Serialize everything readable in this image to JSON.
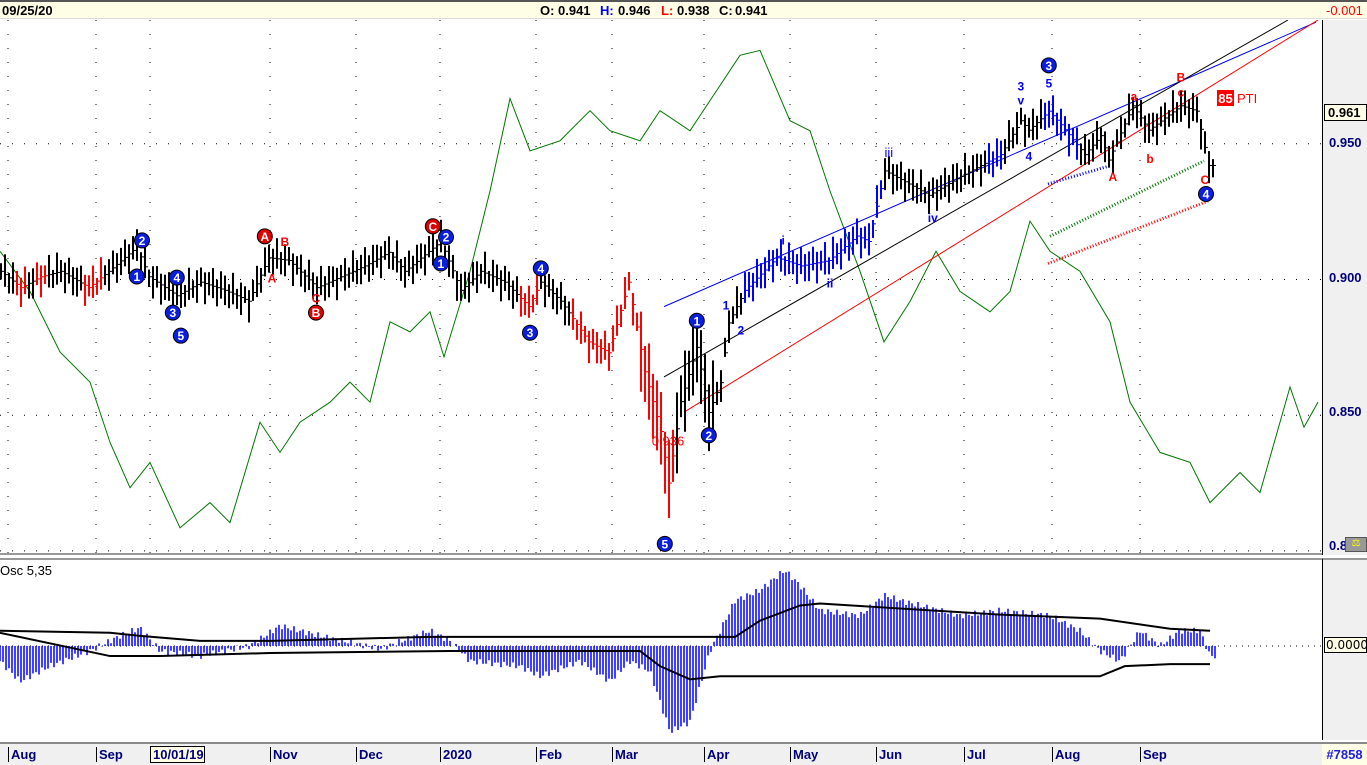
{
  "header": {
    "date": "09/25/20",
    "open_label": "O:",
    "open": "0.941",
    "high_label": "H:",
    "high": "0.946",
    "low_label": "L:",
    "low": "0.938",
    "close_label": "C:",
    "close": "0.941",
    "change": "-0.001"
  },
  "price_axis": {
    "ticks": [
      "0.950",
      "0.900",
      "0.850",
      "0.8"
    ],
    "current": "0.961"
  },
  "osc_panel": {
    "title": "Osc 5,35",
    "zero_label": "0.0000"
  },
  "x_axis": {
    "labels": [
      "Aug",
      "Sep",
      "10/01/19",
      "Nov",
      "Dec",
      "2020",
      "Feb",
      "Mar",
      "Apr",
      "May",
      "Jun",
      "Jul",
      "Aug",
      "Sep"
    ]
  },
  "record": "#7858",
  "pti": {
    "value": "85",
    "label": "PTI"
  },
  "colors": {
    "up": "#000000",
    "red": "#ff0000",
    "blue": "#0000ff",
    "green": "#007700"
  },
  "chart_data": {
    "type": "ohlc",
    "title": "09/25/20",
    "ylim": [
      0.7985,
      0.9956
    ],
    "yticks": [
      0.95,
      0.9,
      0.85,
      0.8
    ],
    "bar_count": 304,
    "month_starts": [
      2,
      24,
      37.5,
      67.5,
      89,
      110,
      134,
      153,
      176,
      197.5,
      219,
      241,
      263,
      285
    ],
    "price_path": [
      [
        0,
        0.903
      ],
      [
        5,
        0.897
      ],
      [
        10,
        0.901
      ],
      [
        15,
        0.903
      ],
      [
        22,
        0.897
      ],
      [
        27,
        0.903
      ],
      [
        34,
        0.912
      ],
      [
        37,
        0.901
      ],
      [
        44,
        0.894
      ],
      [
        50,
        0.899
      ],
      [
        56,
        0.896
      ],
      [
        62,
        0.892
      ],
      [
        67,
        0.908
      ],
      [
        72,
        0.907
      ],
      [
        79,
        0.897
      ],
      [
        85,
        0.901
      ],
      [
        91,
        0.905
      ],
      [
        97,
        0.91
      ],
      [
        101,
        0.903
      ],
      [
        110,
        0.914
      ],
      [
        115,
        0.896
      ],
      [
        120,
        0.903
      ],
      [
        126,
        0.899
      ],
      [
        132,
        0.89
      ],
      [
        135,
        0.899
      ],
      [
        140,
        0.892
      ],
      [
        147,
        0.877
      ],
      [
        152,
        0.873
      ],
      [
        157,
        0.899
      ],
      [
        161,
        0.866
      ],
      [
        165,
        0.844
      ],
      [
        167,
        0.825
      ],
      [
        170,
        0.855
      ],
      [
        174,
        0.875
      ],
      [
        177,
        0.851
      ],
      [
        180,
        0.862
      ],
      [
        182,
        0.884
      ],
      [
        186,
        0.896
      ],
      [
        194,
        0.908
      ],
      [
        200,
        0.905
      ],
      [
        207,
        0.907
      ],
      [
        214,
        0.916
      ],
      [
        217,
        0.914
      ],
      [
        221,
        0.94
      ],
      [
        226,
        0.936
      ],
      [
        232,
        0.931
      ],
      [
        240,
        0.938
      ],
      [
        250,
        0.946
      ],
      [
        255,
        0.9585
      ],
      [
        257,
        0.955
      ],
      [
        262,
        0.962
      ],
      [
        265,
        0.957
      ],
      [
        271,
        0.946
      ],
      [
        275,
        0.953
      ],
      [
        277,
        0.944
      ],
      [
        283,
        0.964
      ],
      [
        287,
        0.955
      ],
      [
        295,
        0.964
      ],
      [
        299,
        0.962
      ],
      [
        302,
        0.942
      ]
    ],
    "color_ranges": [
      [
        4,
        6,
        "red"
      ],
      [
        9,
        11,
        "red"
      ],
      [
        21,
        25,
        "red"
      ],
      [
        130,
        134,
        "red"
      ],
      [
        143,
        168,
        "red"
      ],
      [
        186,
        220,
        "blue"
      ],
      [
        247,
        250,
        "blue"
      ],
      [
        261,
        269,
        "blue"
      ]
    ],
    "overlay_line": [
      [
        0,
        0.9104
      ],
      [
        7.5,
        0.8956
      ],
      [
        15,
        0.8733
      ],
      [
        22.5,
        0.8622
      ],
      [
        27.5,
        0.84
      ],
      [
        32.5,
        0.8233
      ],
      [
        37.5,
        0.8326
      ],
      [
        45,
        0.8085
      ],
      [
        52.5,
        0.8178
      ],
      [
        57.5,
        0.8104
      ],
      [
        65,
        0.8474
      ],
      [
        70,
        0.8363
      ],
      [
        75,
        0.8474
      ],
      [
        82.5,
        0.8548
      ],
      [
        87.5,
        0.8622
      ],
      [
        92.5,
        0.8548
      ],
      [
        97.5,
        0.8844
      ],
      [
        102.5,
        0.8807
      ],
      [
        107.5,
        0.8881
      ],
      [
        111,
        0.8715
      ],
      [
        117.5,
        0.903
      ],
      [
        122.5,
        0.9326
      ],
      [
        127.5,
        0.9667
      ],
      [
        132.5,
        0.9474
      ],
      [
        140,
        0.9511
      ],
      [
        147.5,
        0.9622
      ],
      [
        152.5,
        0.9548
      ],
      [
        160,
        0.9511
      ],
      [
        165,
        0.9622
      ],
      [
        172.5,
        0.9548
      ],
      [
        177.5,
        0.9659
      ],
      [
        185,
        0.9826
      ],
      [
        190,
        0.9844
      ],
      [
        197.5,
        0.9585
      ],
      [
        202.5,
        0.9548
      ],
      [
        207.5,
        0.9326
      ],
      [
        215,
        0.903
      ],
      [
        221,
        0.877
      ],
      [
        227.5,
        0.8919
      ],
      [
        234,
        0.9104
      ],
      [
        240,
        0.8956
      ],
      [
        247.5,
        0.8881
      ],
      [
        252.5,
        0.8956
      ],
      [
        257.5,
        0.9215
      ],
      [
        262.5,
        0.9104
      ],
      [
        270,
        0.903
      ],
      [
        277.5,
        0.8844
      ],
      [
        282.5,
        0.8548
      ],
      [
        290,
        0.8363
      ],
      [
        297.5,
        0.8326
      ],
      [
        302.5,
        0.8178
      ],
      [
        310,
        0.8289
      ],
      [
        315,
        0.8215
      ],
      [
        322.5,
        0.8604
      ],
      [
        326,
        0.8456
      ],
      [
        329.5,
        0.8548
      ]
    ],
    "channels": [
      {
        "color": "blue",
        "from": [
          166,
          0.89
        ],
        "to": [
          329,
          0.9948
        ]
      },
      {
        "color": "black",
        "from": [
          166,
          0.8641
        ],
        "to": [
          322,
          0.9956
        ]
      },
      {
        "color": "red",
        "from": [
          171,
          0.8511
        ],
        "to": [
          329.5,
          0.9956
        ]
      }
    ],
    "projection_curves": [
      {
        "color": "blue",
        "from": [
          262,
          0.9352
        ],
        "to": [
          277.5,
          0.9419
        ]
      },
      {
        "color": "green",
        "from": [
          262.5,
          0.9159
        ],
        "to": [
          301,
          0.9437
        ]
      },
      {
        "color": "red",
        "from": [
          262,
          0.9059
        ],
        "to": [
          302,
          0.9289
        ]
      }
    ],
    "wave_labels": [
      {
        "t": "2",
        "x": 35.5,
        "y": 0.9144,
        "s": "bc"
      },
      {
        "t": "1",
        "x": 34.2,
        "y": 0.9011,
        "s": "bc"
      },
      {
        "t": "4",
        "x": 44.2,
        "y": 0.9007,
        "s": "bc"
      },
      {
        "t": "3",
        "x": 43.2,
        "y": 0.8878,
        "s": "bc"
      },
      {
        "t": "5",
        "x": 45.2,
        "y": 0.8793,
        "s": "bc"
      },
      {
        "t": "2",
        "x": 111.5,
        "y": 0.9156,
        "s": "bc"
      },
      {
        "t": "1",
        "x": 110.2,
        "y": 0.9059,
        "s": "bc"
      },
      {
        "t": "4",
        "x": 135.2,
        "y": 0.9041,
        "s": "bc"
      },
      {
        "t": "3",
        "x": 132.5,
        "y": 0.8804,
        "s": "bc"
      },
      {
        "t": "1",
        "x": 174.2,
        "y": 0.8848,
        "s": "bc"
      },
      {
        "t": "2",
        "x": 177.2,
        "y": 0.8426,
        "s": "bc"
      },
      {
        "t": "5",
        "x": 166.2,
        "y": 0.8026,
        "s": "bc"
      },
      {
        "t": "3",
        "x": 262.2,
        "y": 0.9789,
        "s": "bc"
      },
      {
        "t": "4",
        "x": 301.5,
        "y": 0.9315,
        "s": "bc"
      },
      {
        "t": "A",
        "x": 66.2,
        "y": 0.9159,
        "s": "rc"
      },
      {
        "t": "B",
        "x": 79,
        "y": 0.8878,
        "s": "rc"
      },
      {
        "t": "C",
        "x": 108.2,
        "y": 0.9196,
        "s": "rc"
      },
      {
        "t": "B",
        "x": 71.2,
        "y": 0.9141,
        "s": "rt"
      },
      {
        "t": "A",
        "x": 68,
        "y": 0.9007,
        "s": "rt"
      },
      {
        "t": "C",
        "x": 79,
        "y": 0.8933,
        "s": "rt"
      },
      {
        "t": "a",
        "x": 283.5,
        "y": 0.9678,
        "s": "rt"
      },
      {
        "t": "b",
        "x": 287.5,
        "y": 0.9448,
        "s": "rt"
      },
      {
        "t": "A",
        "x": 278.2,
        "y": 0.9381,
        "s": "rt"
      },
      {
        "t": "B",
        "x": 295.2,
        "y": 0.9748,
        "s": "rt"
      },
      {
        "t": "c",
        "x": 295.2,
        "y": 0.9693,
        "s": "rt"
      },
      {
        "t": "C",
        "x": 301.2,
        "y": 0.937,
        "s": "rt"
      },
      {
        "t": "0.936",
        "x": 167,
        "y": 0.8407,
        "s": "rt"
      },
      {
        "t": "1",
        "x": 181.5,
        "y": 0.8907,
        "s": "bt"
      },
      {
        "t": "2",
        "x": 185.2,
        "y": 0.8815,
        "s": "bt"
      },
      {
        "t": "i",
        "x": 195.8,
        "y": 0.9148,
        "s": "bt"
      },
      {
        "t": "ii",
        "x": 207.5,
        "y": 0.8989,
        "s": "bt"
      },
      {
        "t": "iii",
        "x": 222.2,
        "y": 0.947,
        "s": "bt"
      },
      {
        "t": "iv",
        "x": 233.2,
        "y": 0.923,
        "s": "bt"
      },
      {
        "t": "3",
        "x": 255.2,
        "y": 0.9715,
        "s": "bt"
      },
      {
        "t": "v",
        "x": 255.2,
        "y": 0.9663,
        "s": "bt"
      },
      {
        "t": "5",
        "x": 262.2,
        "y": 0.9726,
        "s": "bt"
      },
      {
        "t": "4",
        "x": 257.2,
        "y": 0.9456,
        "s": "bt"
      }
    ],
    "oscillator": {
      "name": "Osc 5,35",
      "ylim": [
        -0.038,
        0.034
      ],
      "histogram": [
        [
          0,
          -0.006
        ],
        [
          5,
          -0.014
        ],
        [
          12.5,
          -0.008
        ],
        [
          22.5,
          -0.002
        ],
        [
          30,
          0.004
        ],
        [
          35,
          0.0072
        ],
        [
          40,
          -0.002
        ],
        [
          50,
          -0.004
        ],
        [
          62.5,
          0
        ],
        [
          70,
          0.008
        ],
        [
          80,
          0.004
        ],
        [
          95,
          -0.0012
        ],
        [
          107.5,
          0.006
        ],
        [
          112.5,
          0.002
        ],
        [
          117.5,
          -0.006
        ],
        [
          130,
          -0.008
        ],
        [
          135,
          -0.012
        ],
        [
          145,
          -0.006
        ],
        [
          152.5,
          -0.014
        ],
        [
          157.5,
          -0.006
        ],
        [
          162.5,
          -0.01
        ],
        [
          167.5,
          -0.034
        ],
        [
          172.5,
          -0.03
        ],
        [
          177.5,
          -0.002
        ],
        [
          183.8,
          0.018
        ],
        [
          190,
          0.022
        ],
        [
          196.2,
          0.03
        ],
        [
          200,
          0.024
        ],
        [
          205,
          0.014
        ],
        [
          215,
          0.012
        ],
        [
          221.2,
          0.02
        ],
        [
          225,
          0.018
        ],
        [
          240,
          0.012
        ],
        [
          250,
          0.014
        ],
        [
          262.5,
          0.012
        ],
        [
          270,
          0.006
        ],
        [
          275,
          -0.002
        ],
        [
          280,
          -0.006
        ],
        [
          285,
          0.006
        ],
        [
          290,
          0
        ],
        [
          295,
          0.006
        ],
        [
          300,
          0.006
        ],
        [
          302.5,
          -0.004
        ]
      ],
      "upper_band": [
        [
          0,
          0.006
        ],
        [
          27.5,
          0.0052
        ],
        [
          35,
          0.004
        ],
        [
          50,
          0.002
        ],
        [
          67.5,
          0.002
        ],
        [
          87.5,
          0.0028
        ],
        [
          107.5,
          0.0036
        ],
        [
          160,
          0.0036
        ],
        [
          183.8,
          0.0036
        ],
        [
          190,
          0.01
        ],
        [
          200,
          0.016
        ],
        [
          205,
          0.0168
        ],
        [
          225,
          0.0148
        ],
        [
          250,
          0.0124
        ],
        [
          275,
          0.0108
        ],
        [
          292.5,
          0.0068
        ],
        [
          302.5,
          0.006
        ]
      ],
      "lower_band": [
        [
          0,
          0.0052
        ],
        [
          27.5,
          -0.004
        ],
        [
          40,
          -0.004
        ],
        [
          67.5,
          -0.0028
        ],
        [
          112.5,
          -0.002
        ],
        [
          160,
          -0.002
        ],
        [
          165,
          -0.008
        ],
        [
          172.5,
          -0.0132
        ],
        [
          180,
          -0.012
        ],
        [
          275,
          -0.012
        ],
        [
          281.2,
          -0.008
        ],
        [
          292.5,
          -0.0072
        ],
        [
          302.5,
          -0.0072
        ]
      ]
    }
  }
}
